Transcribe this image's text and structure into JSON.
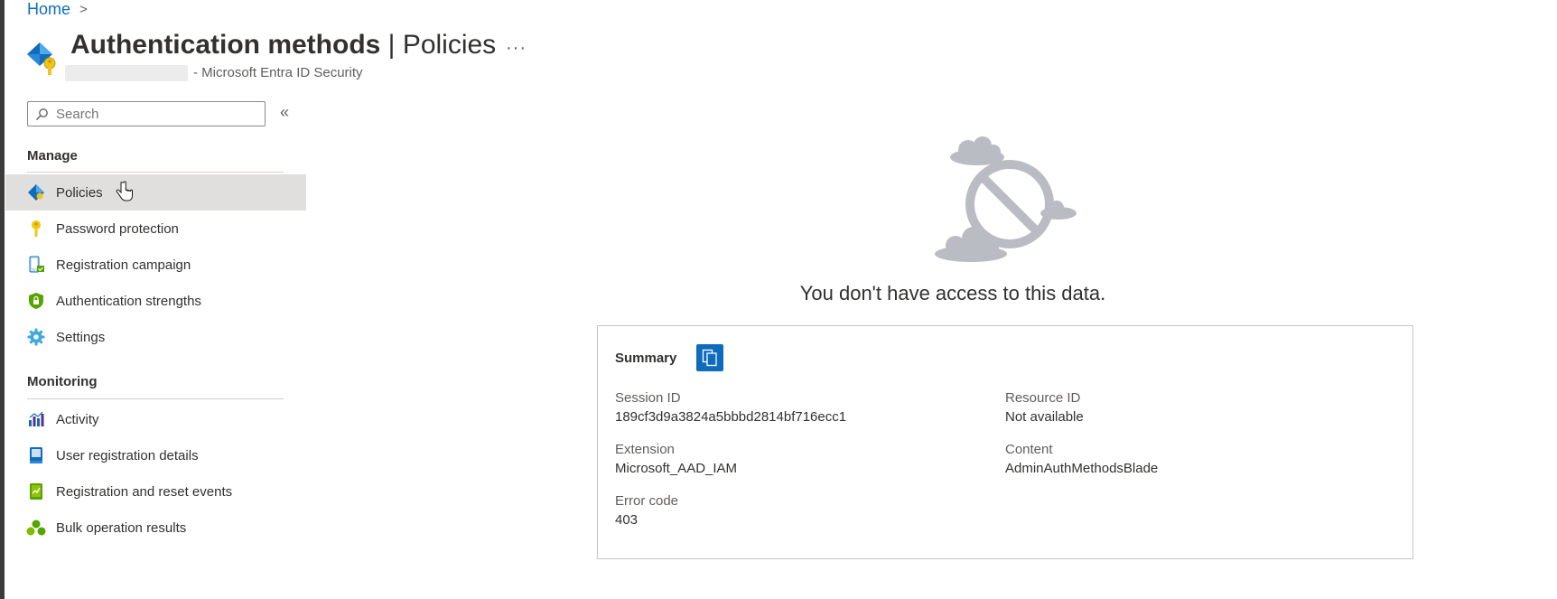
{
  "breadcrumb": {
    "home": "Home",
    "separator": ">"
  },
  "header": {
    "title_main": "Authentication methods",
    "title_separator": " | ",
    "title_sub": "Policies",
    "more": "···",
    "subtitle": "- Microsoft Entra ID Security"
  },
  "search": {
    "placeholder": "Search",
    "value": ""
  },
  "collapse_glyph": "«",
  "sections": {
    "manage": "Manage",
    "monitoring": "Monitoring"
  },
  "nav": {
    "manage": [
      {
        "label": "Policies",
        "icon": "policies-icon",
        "active": true
      },
      {
        "label": "Password protection",
        "icon": "key-icon"
      },
      {
        "label": "Registration campaign",
        "icon": "registration-campaign-icon"
      },
      {
        "label": "Authentication strengths",
        "icon": "shield-lock-icon"
      },
      {
        "label": "Settings",
        "icon": "gear-icon"
      }
    ],
    "monitoring": [
      {
        "label": "Activity",
        "icon": "activity-chart-icon"
      },
      {
        "label": "User registration details",
        "icon": "book-icon"
      },
      {
        "label": "Registration and reset events",
        "icon": "events-icon"
      },
      {
        "label": "Bulk operation results",
        "icon": "bulk-operations-icon"
      }
    ]
  },
  "main": {
    "no_access_message": "You don't have access to this data.",
    "summary": {
      "title": "Summary",
      "session_id_label": "Session ID",
      "session_id": "189cf3d9a3824a5bbbd2814bf716ecc1",
      "resource_id_label": "Resource ID",
      "resource_id": "Not available",
      "extension_label": "Extension",
      "extension": "Microsoft_AAD_IAM",
      "content_label": "Content",
      "content": "AdminAuthMethodsBlade",
      "error_code_label": "Error code",
      "error_code": "403"
    }
  },
  "colors": {
    "link": "#0f6cbd",
    "accent": "#0f6cbd",
    "nav_active": "#e1dfdd",
    "illustration": "#b9bcc2"
  }
}
